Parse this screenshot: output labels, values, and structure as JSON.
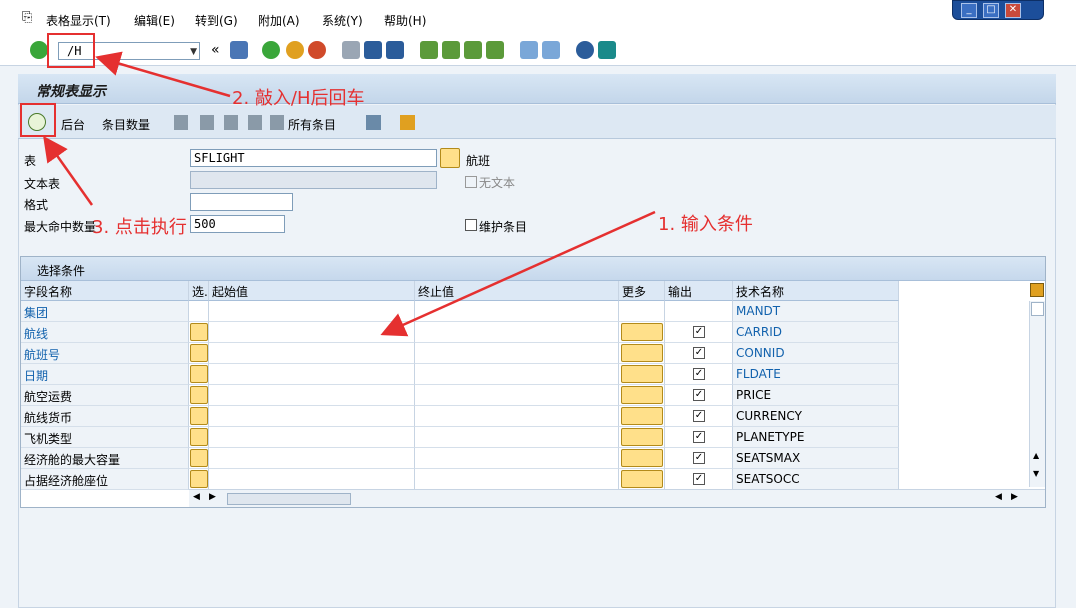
{
  "menubar": {
    "items": [
      "表格显示(T)",
      "编辑(E)",
      "转到(G)",
      "附加(A)",
      "系统(Y)",
      "帮助(H)"
    ]
  },
  "toolbar": {
    "command_value": "/H"
  },
  "page": {
    "title": "常规表显示"
  },
  "app_toolbar": {
    "background_label": "后台",
    "entry_count_label": "条目数量",
    "all_entries_label": "所有条目"
  },
  "form": {
    "table_label": "表",
    "table_value": "SFLIGHT",
    "table_desc": "航班",
    "text_table_label": "文本表",
    "no_text_label": "无文本",
    "layout_label": "格式",
    "max_hits_label": "最大命中数量",
    "max_hits_value": "500",
    "maintain_entries_label": "维护条目"
  },
  "grid": {
    "title": "选择条件",
    "headers": [
      "字段名称",
      "选.",
      "起始值",
      "终止值",
      "更多",
      "输出",
      "技术名称"
    ],
    "rows": [
      {
        "name": "集团",
        "tech": "MANDT",
        "key": true,
        "selectable": false,
        "output": null
      },
      {
        "name": "航线",
        "tech": "CARRID",
        "key": true,
        "selectable": true,
        "output": true
      },
      {
        "name": "航班号",
        "tech": "CONNID",
        "key": true,
        "selectable": true,
        "output": true
      },
      {
        "name": "日期",
        "tech": "FLDATE",
        "key": true,
        "selectable": true,
        "output": true
      },
      {
        "name": "航空运费",
        "tech": "PRICE",
        "key": false,
        "selectable": true,
        "output": true
      },
      {
        "name": "航线货币",
        "tech": "CURRENCY",
        "key": false,
        "selectable": true,
        "output": true
      },
      {
        "name": "飞机类型",
        "tech": "PLANETYPE",
        "key": false,
        "selectable": true,
        "output": true
      },
      {
        "name": "经济舱的最大容量",
        "tech": "SEATSMAX",
        "key": false,
        "selectable": true,
        "output": true
      },
      {
        "name": "占据经济舱座位",
        "tech": "SEATSOCC",
        "key": false,
        "selectable": true,
        "output": true
      }
    ]
  },
  "annotations": {
    "step1": "1. 输入条件",
    "step2": "2. 敲入/H后回车",
    "step3": "3. 点击执行"
  },
  "colors": {
    "annotation": "#e53030",
    "key_field": "#1262ad"
  },
  "icons": [
    "enter-icon",
    "save-icon",
    "back-icon",
    "exit-icon",
    "cancel-icon",
    "print-icon",
    "find-icon",
    "find-next-icon",
    "first-page-icon",
    "prev-page-icon",
    "next-page-icon",
    "last-page-icon",
    "new-session-icon",
    "shortcut-icon",
    "help-icon",
    "customize-icon",
    "execute-icon",
    "multiple-selection-icon",
    "checkbox-icon"
  ]
}
